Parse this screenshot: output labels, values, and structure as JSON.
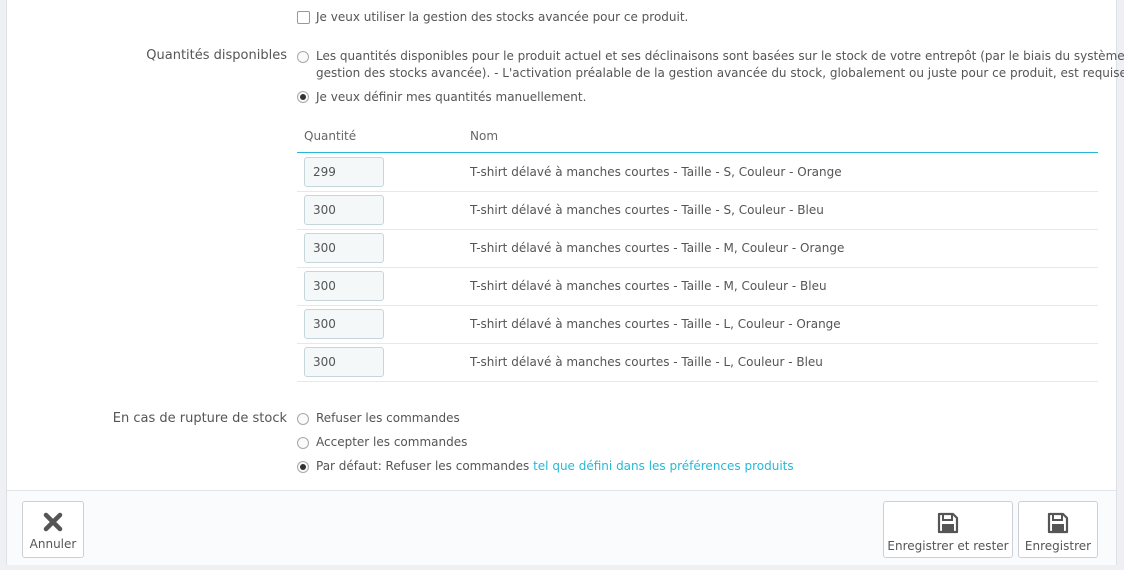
{
  "stock": {
    "advanced_checkbox_label": "Je veux utiliser la gestion des stocks avancée pour ce produit."
  },
  "quantities": {
    "section_label": "Quantités disponibles",
    "option_advanced_line1": "Les quantités disponibles pour le produit actuel et ses déclinaisons sont basées sur le stock de votre entrepôt (par le biais du système de",
    "option_advanced_line2": "gestion des stocks avancée).  - L'activation préalable de la gestion avancée du stock, globalement ou juste pour ce produit, est requise.",
    "option_manual": "Je veux définir mes quantités manuellement.",
    "col_quantity": "Quantité",
    "col_name": "Nom",
    "rows": [
      {
        "qty": "299",
        "name": "T-shirt délavé à manches courtes - Taille - S, Couleur - Orange"
      },
      {
        "qty": "300",
        "name": "T-shirt délavé à manches courtes - Taille - S, Couleur - Bleu"
      },
      {
        "qty": "300",
        "name": "T-shirt délavé à manches courtes - Taille - M, Couleur - Orange"
      },
      {
        "qty": "300",
        "name": "T-shirt délavé à manches courtes - Taille - M, Couleur - Bleu"
      },
      {
        "qty": "300",
        "name": "T-shirt délavé à manches courtes - Taille - L, Couleur - Orange"
      },
      {
        "qty": "300",
        "name": "T-shirt délavé à manches courtes - Taille - L, Couleur - Bleu"
      }
    ]
  },
  "out_of_stock": {
    "section_label": "En cas de rupture de stock",
    "option_refuse": "Refuser les commandes",
    "option_accept": "Accepter les commandes",
    "option_default": "Par défaut: Refuser les commandes",
    "option_default_link": "tel que défini dans les préférences produits"
  },
  "footer": {
    "cancel_label": "Annuler",
    "save_stay_label": "Enregistrer et rester",
    "save_label": "Enregistrer"
  },
  "colors": {
    "link": "#25b9d7",
    "table_header_line": "#25b9d7"
  }
}
